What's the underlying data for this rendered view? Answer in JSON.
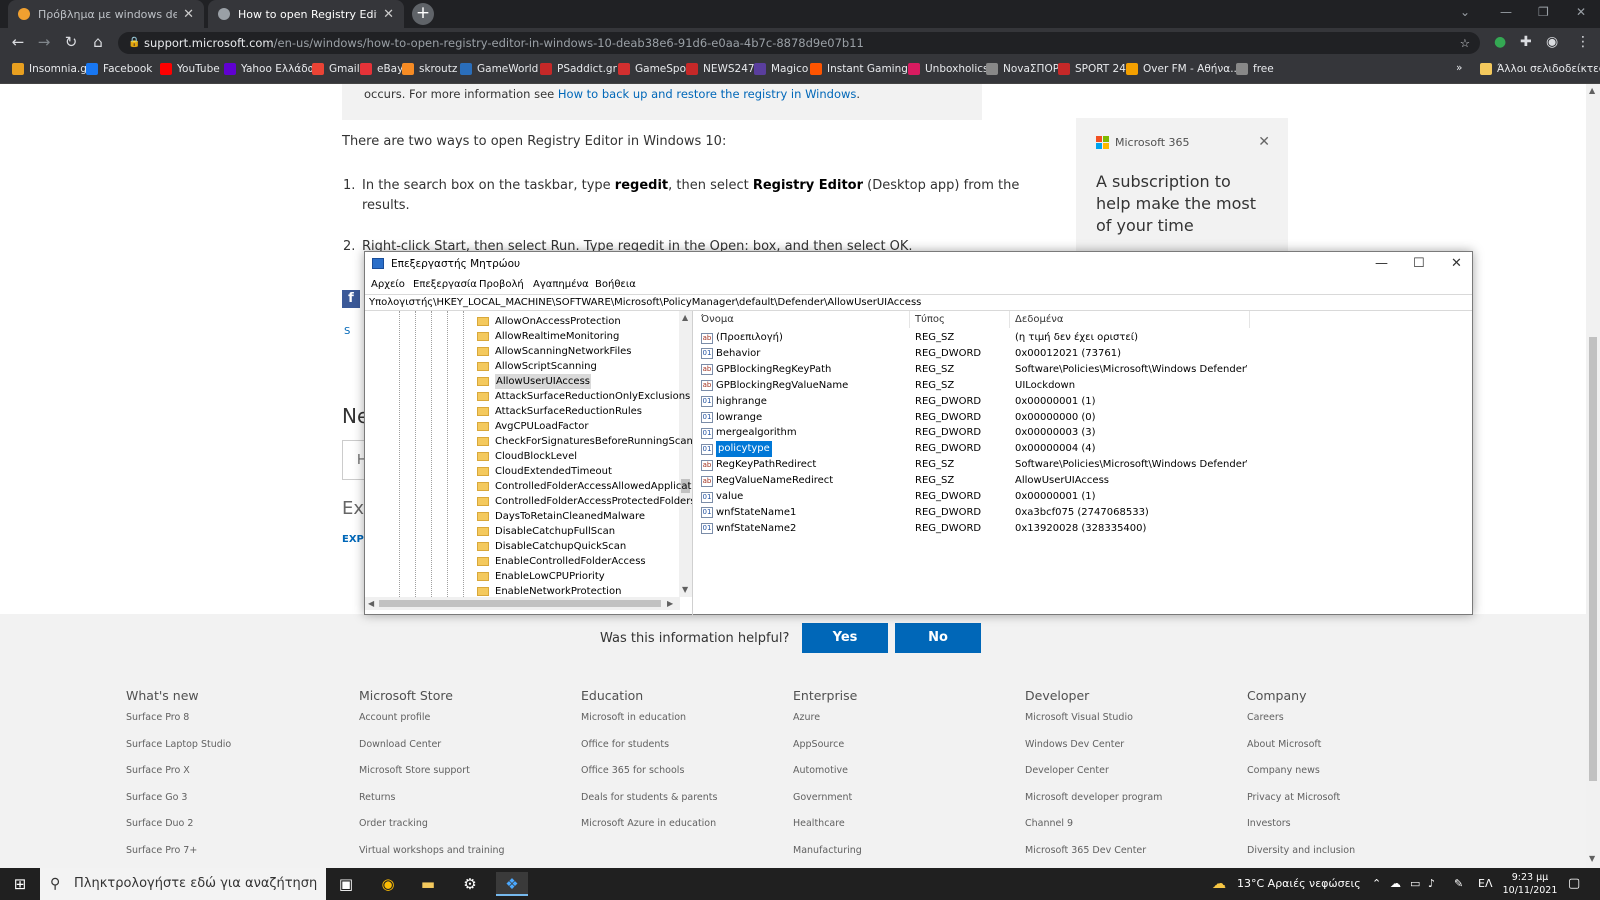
{
  "browser": {
    "tabs": [
      {
        "title": "Πρόβλημα με windows defender",
        "favicon_color": "#f0a030"
      },
      {
        "title": "How to open Registry Editor in W",
        "favicon_color": "#9aa0a6"
      }
    ],
    "address": {
      "host": "support.microsoft.com",
      "path": "/en-us/windows/how-to-open-registry-editor-in-windows-10-deab38e6-91d6-e0aa-4b7c-8878d9e07b11"
    },
    "bookmarks": [
      {
        "label": "Insomnia.gr",
        "color": "#e8a020"
      },
      {
        "label": "Facebook",
        "color": "#1877f2"
      },
      {
        "label": "YouTube",
        "color": "#ff0000"
      },
      {
        "label": "Yahoo Ελλάδας",
        "color": "#6001d2"
      },
      {
        "label": "Gmail",
        "color": "#ea4335"
      },
      {
        "label": "eBay",
        "color": "#e53238"
      },
      {
        "label": "skroutz",
        "color": "#f68b24"
      },
      {
        "label": "GameWorld",
        "color": "#2a6ebb"
      },
      {
        "label": "PSaddict.gr",
        "color": "#c62828"
      },
      {
        "label": "GameSpot",
        "color": "#d32f2f"
      },
      {
        "label": "NEWS247",
        "color": "#c62828"
      },
      {
        "label": "Magico",
        "color": "#5a3e9e"
      },
      {
        "label": "Instant Gaming",
        "color": "#ff5400"
      },
      {
        "label": "Unboxholics",
        "color": "#d81b60"
      },
      {
        "label": "NovaΣΠΟΡ",
        "color": "#888888"
      },
      {
        "label": "SPORT 24",
        "color": "#c62828"
      },
      {
        "label": "Over FM - Αθήνα...",
        "color": "#f4a000"
      },
      {
        "label": "free",
        "color": "#888888"
      }
    ],
    "bookmarks_more": "»",
    "other_bookmarks": "Άλλοι σελιδοδείκτες"
  },
  "article": {
    "note_text": "occurs. For more information see ",
    "note_link": "How to back up and restore the registry in Windows",
    "note_end": ".",
    "intro": "There are two ways to open Registry Editor in Windows 10:",
    "step1_num": "1.",
    "step1_a": "In the search box on the taskbar, type ",
    "step1_b": "regedit",
    "step1_c": ", then select ",
    "step1_d": "Registry Editor",
    "step1_e": " (Desktop app) from the",
    "step1_f": "results.",
    "step2_num": "2.",
    "step2_text": "Right-click Start, then select Run. Type regedit in the Open: box, and then select OK.",
    "side_label_s": "S",
    "side_label_ne": "Ne",
    "side_label_h": "H",
    "side_label_exp": "Exp",
    "side_label_expl": "EXP"
  },
  "sidebox": {
    "brand": "Microsoft 365",
    "promo": "A subscription to help make the most of your time",
    "logo_colors": [
      "#f25022",
      "#7fba00",
      "#00a4ef",
      "#ffb900"
    ]
  },
  "help": {
    "question": "Was this information helpful?",
    "yes": "Yes",
    "no": "No",
    "button_color": "#0067b8"
  },
  "footer": {
    "columns": [
      {
        "title": "What's new",
        "items": [
          "Surface Pro 8",
          "Surface Laptop Studio",
          "Surface Pro X",
          "Surface Go 3",
          "Surface Duo 2",
          "Surface Pro 7+"
        ]
      },
      {
        "title": "Microsoft Store",
        "items": [
          "Account profile",
          "Download Center",
          "Microsoft Store support",
          "Returns",
          "Order tracking",
          "Virtual workshops and training"
        ]
      },
      {
        "title": "Education",
        "items": [
          "Microsoft in education",
          "Office for students",
          "Office 365 for schools",
          "Deals for students & parents",
          "Microsoft Azure in education"
        ]
      },
      {
        "title": "Enterprise",
        "items": [
          "Azure",
          "AppSource",
          "Automotive",
          "Government",
          "Healthcare",
          "Manufacturing"
        ]
      },
      {
        "title": "Developer",
        "items": [
          "Microsoft Visual Studio",
          "Windows Dev Center",
          "Developer Center",
          "Microsoft developer program",
          "Channel 9",
          "Microsoft 365 Dev Center"
        ]
      },
      {
        "title": "Company",
        "items": [
          "Careers",
          "About Microsoft",
          "Company news",
          "Privacy at Microsoft",
          "Investors",
          "Diversity and inclusion"
        ]
      }
    ]
  },
  "regedit": {
    "title": "Επεξεργαστής Μητρώου",
    "menu": [
      "Αρχείο",
      "Επεξεργασία",
      "Προβολή",
      "Αγαπημένα",
      "Βοήθεια"
    ],
    "address": "Υπολογιστής\\HKEY_LOCAL_MACHINE\\SOFTWARE\\Microsoft\\PolicyManager\\default\\Defender\\AllowUserUIAccess",
    "tree": [
      "AllowOnAccessProtection",
      "AllowRealtimeMonitoring",
      "AllowScanningNetworkFiles",
      "AllowScriptScanning",
      "AllowUserUIAccess",
      "AttackSurfaceReductionOnlyExclusions",
      "AttackSurfaceReductionRules",
      "AvgCPULoadFactor",
      "CheckForSignaturesBeforeRunningScan",
      "CloudBlockLevel",
      "CloudExtendedTimeout",
      "ControlledFolderAccessAllowedApplications",
      "ControlledFolderAccessProtectedFolders",
      "DaysToRetainCleanedMalware",
      "DisableCatchupFullScan",
      "DisableCatchupQuickScan",
      "EnableControlledFolderAccess",
      "EnableLowCPUPriority",
      "EnableNetworkProtection"
    ],
    "selected_tree": "AllowUserUIAccess",
    "columns": [
      "Όνομα",
      "Τύπος",
      "Δεδομένα"
    ],
    "values": [
      {
        "name": "(Προεπιλογή)",
        "type": "REG_SZ",
        "data": "(η τιμή δεν έχει οριστεί)",
        "icon": "ab"
      },
      {
        "name": "Behavior",
        "type": "REG_DWORD",
        "data": "0x00012021 (73761)",
        "icon": "bin"
      },
      {
        "name": "GPBlockingRegKeyPath",
        "type": "REG_SZ",
        "data": "Software\\Policies\\Microsoft\\Windows Defender\\U...",
        "icon": "ab"
      },
      {
        "name": "GPBlockingRegValueName",
        "type": "REG_SZ",
        "data": "UILockdown",
        "icon": "ab"
      },
      {
        "name": "highrange",
        "type": "REG_DWORD",
        "data": "0x00000001 (1)",
        "icon": "bin"
      },
      {
        "name": "lowrange",
        "type": "REG_DWORD",
        "data": "0x00000000 (0)",
        "icon": "bin"
      },
      {
        "name": "mergealgorithm",
        "type": "REG_DWORD",
        "data": "0x00000003 (3)",
        "icon": "bin"
      },
      {
        "name": "policytype",
        "type": "REG_DWORD",
        "data": "0x00000004 (4)",
        "icon": "bin"
      },
      {
        "name": "RegKeyPathRedirect",
        "type": "REG_SZ",
        "data": "Software\\Policies\\Microsoft\\Windows Defender\\P...",
        "icon": "ab"
      },
      {
        "name": "RegValueNameRedirect",
        "type": "REG_SZ",
        "data": "AllowUserUIAccess",
        "icon": "ab"
      },
      {
        "name": "value",
        "type": "REG_DWORD",
        "data": "0x00000001 (1)",
        "icon": "bin"
      },
      {
        "name": "wnfStateName1",
        "type": "REG_DWORD",
        "data": "0xa3bcf075 (2747068533)",
        "icon": "bin"
      },
      {
        "name": "wnfStateName2",
        "type": "REG_DWORD",
        "data": "0x13920028 (328335400)",
        "icon": "bin"
      }
    ],
    "selected_value": "policytype"
  },
  "taskbar": {
    "search_placeholder": "Πληκτρολογήστε εδώ για αναζήτηση",
    "weather": "13°C  Αραιές νεφώσεις",
    "language": "ΕΛ",
    "time": "9:23 μμ",
    "date": "10/11/2021"
  }
}
